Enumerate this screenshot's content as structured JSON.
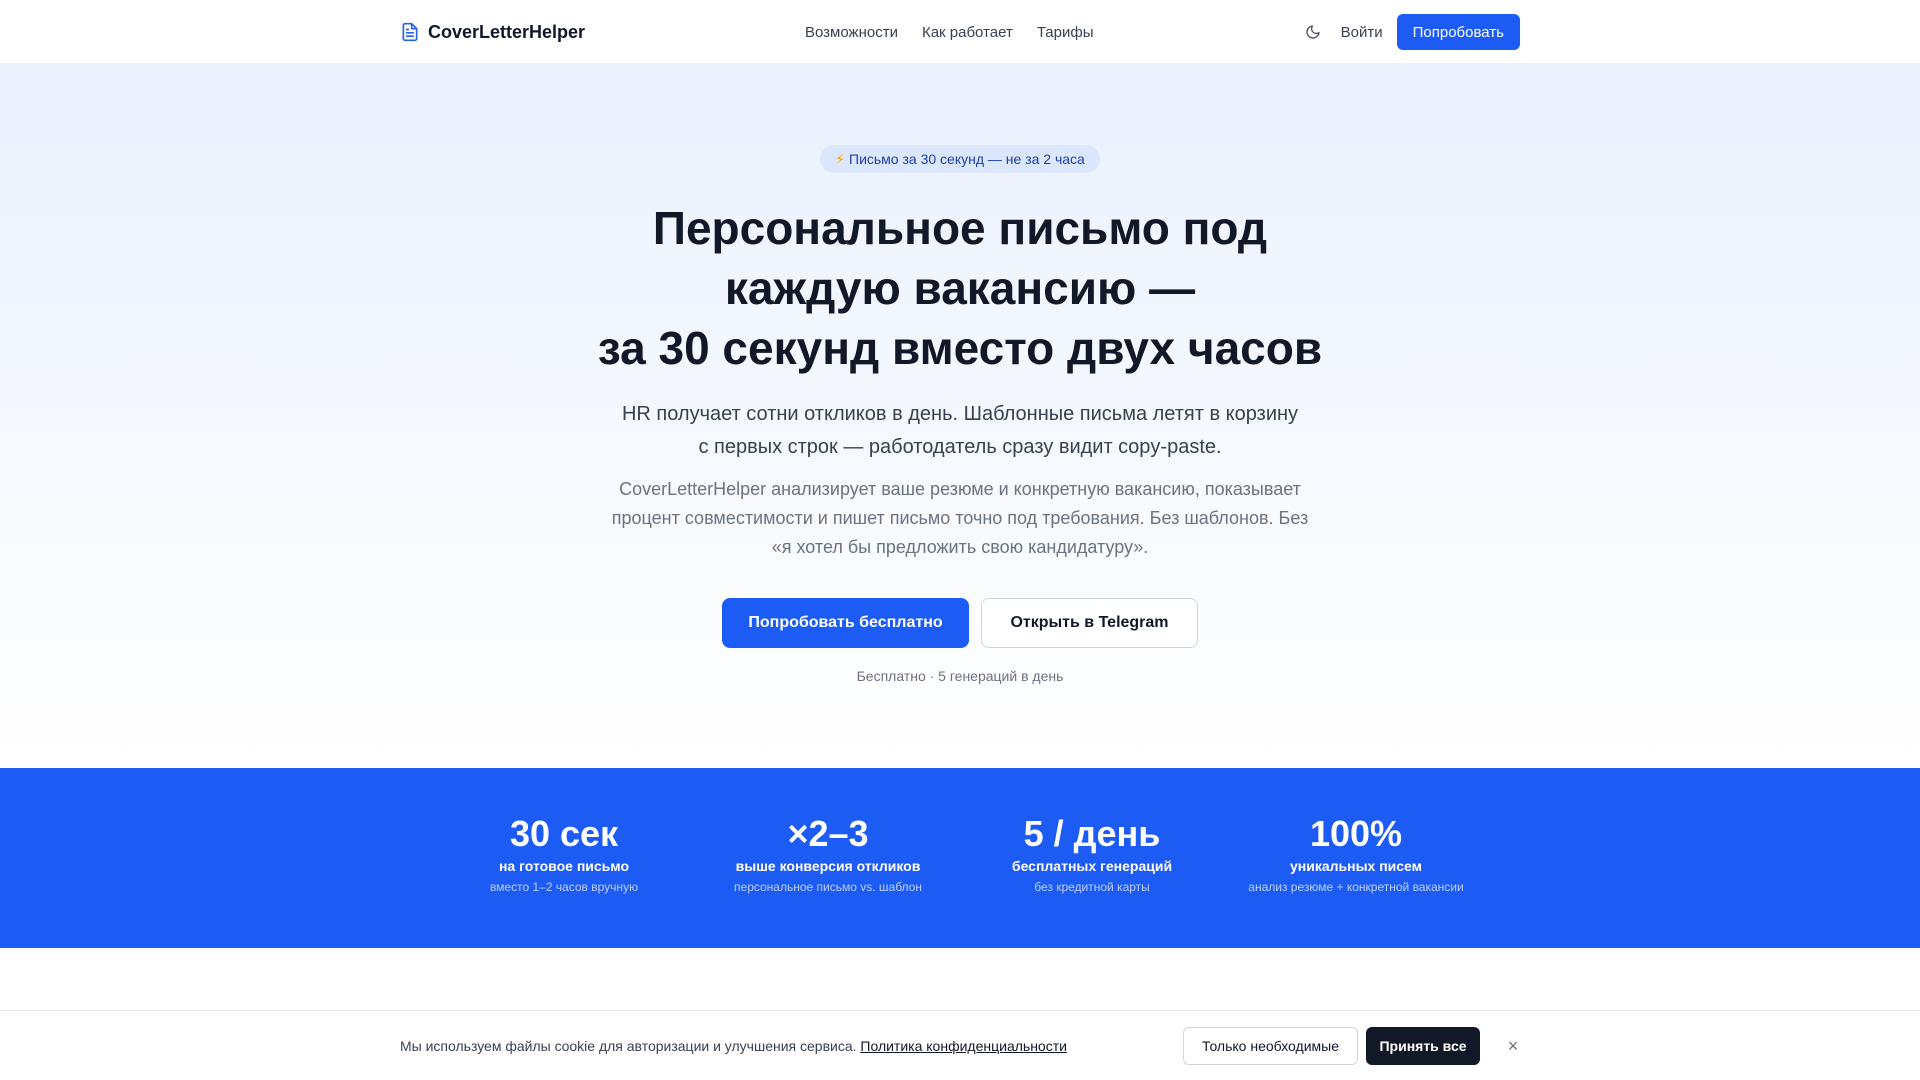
{
  "header": {
    "brand": "CoverLetterHelper",
    "brand_icon": "document-icon",
    "nav": [
      {
        "label": "Возможности"
      },
      {
        "label": "Как работает"
      },
      {
        "label": "Тарифы"
      }
    ],
    "theme_icon": "moon-icon",
    "login_label": "Войти",
    "try_label": "Попробовать"
  },
  "hero": {
    "badge_icon": "⚡",
    "badge_text": "Письмо за 30 секунд — не за 2 часа",
    "title_lines": [
      "Персональное письмо под",
      "каждую вакансию —",
      "за 30 секунд вместо двух часов"
    ],
    "lead": "HR получает сотни откликов в день. Шаблонные письма летят в корзину с первых строк — работодатель сразу видит copy-paste.",
    "sub": "CoverLetterHelper анализирует ваше резюме и конкретную вакансию, показывает процент совместимости и пишет письмо точно под требования. Без шаблонов. Без «я хотел бы предложить свою кандидатуру».",
    "cta_primary": "Попробовать бесплатно",
    "cta_secondary": "Открыть в Telegram",
    "note": "Бесплатно · 5 генераций в день"
  },
  "stats": [
    {
      "value": "30 сек",
      "label": "на готовое письмо",
      "desc": "вместо 1–2 часов вручную"
    },
    {
      "value": "×2–3",
      "label": "выше конверсия откликов",
      "desc": "персональное письмо vs. шаблон"
    },
    {
      "value": "5 / день",
      "label": "бесплатных генераций",
      "desc": "без кредитной карты"
    },
    {
      "value": "100%",
      "label": "уникальных писем",
      "desc": "анализ резюме + конкретной вакансии"
    }
  ],
  "cookie": {
    "text": "Мы используем файлы cookie для авторизации и улучшения сервиса.",
    "policy_link": "Политика конфиденциальности",
    "necessary_label": "Только необходимые",
    "accept_label": "Принять все",
    "close_icon": "×"
  },
  "colors": {
    "accent": "#1d5bf5",
    "dark_button": "#111827"
  }
}
